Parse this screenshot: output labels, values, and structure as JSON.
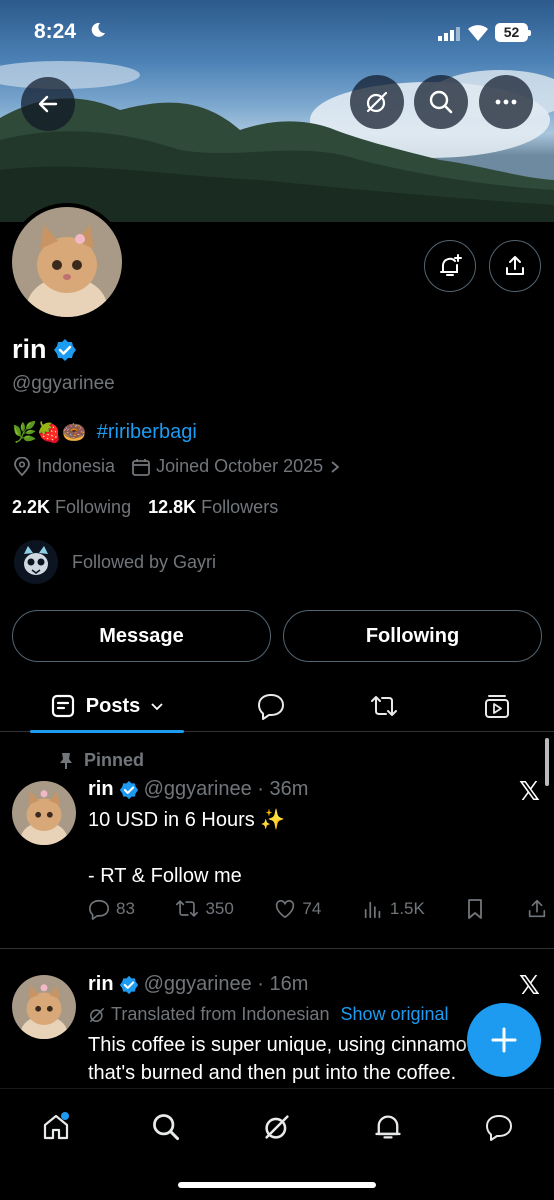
{
  "status_bar": {
    "time": "8:24",
    "battery": "52"
  },
  "header_icons": {
    "back": "arrow-left-icon",
    "grok": "grok-icon",
    "search": "search-icon",
    "more": "more-icon"
  },
  "profile": {
    "name": "rin",
    "handle": "@ggyarinee",
    "bio_emojis": "🌿🍓🍩",
    "bio_hashtag": "#ririberbagi",
    "location": "Indonesia",
    "joined": "Joined October 2025",
    "following_count": "2.2K",
    "following_label": "Following",
    "followers_count": "12.8K",
    "followers_label": "Followers",
    "followed_by": "Followed by Gayri"
  },
  "buttons": {
    "message": "Message",
    "following": "Following"
  },
  "tabs": {
    "posts": "Posts"
  },
  "posts": [
    {
      "pinned_label": "Pinned",
      "name": "rin",
      "meta": "@ggyarinee · 36m",
      "line1": "10 USD in 6 Hours ✨",
      "line2": "- RT & Follow me",
      "replies": "83",
      "reposts": "350",
      "likes": "74",
      "views": "1.5K"
    },
    {
      "name": "rin",
      "meta": "@ggyarinee · 16m",
      "translated": "Translated from Indonesian",
      "show_original": "Show original",
      "line1": "This coffee is super unique, using cinnamon",
      "line2": "that's burned and then put into the coffee."
    }
  ],
  "colors": {
    "accent": "#1d9bf0",
    "muted": "#71767b",
    "border": "#2f3336",
    "background": "#000000"
  }
}
